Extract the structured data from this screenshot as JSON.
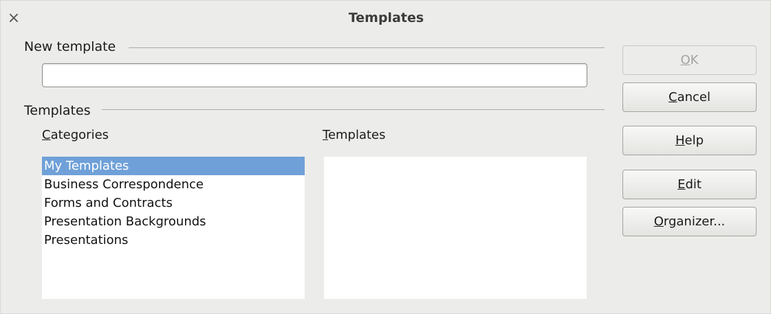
{
  "window": {
    "title": "Templates",
    "close_glyph": "×"
  },
  "new_template": {
    "section_label": "New template",
    "input_value": ""
  },
  "templates_section": {
    "section_label": "Templates",
    "categories": {
      "label_mnemonic": "C",
      "label_rest": "ategories",
      "items": [
        "My Templates",
        "Business Correspondence",
        "Forms and Contracts",
        "Presentation Backgrounds",
        "Presentations"
      ],
      "selected_index": 0
    },
    "templates": {
      "label_mnemonic": "T",
      "label_rest": "emplates",
      "items": []
    }
  },
  "buttons": {
    "ok": {
      "mnemonic": "O",
      "rest": "K",
      "enabled": false
    },
    "cancel": {
      "mnemonic": "C",
      "rest": "ancel",
      "enabled": true
    },
    "help": {
      "mnemonic": "H",
      "rest": "elp",
      "enabled": true
    },
    "edit": {
      "mnemonic": "E",
      "rest": "dit",
      "enabled": true
    },
    "organizer": {
      "mnemonic": "O",
      "rest": "rganizer...",
      "enabled": true
    }
  },
  "colors": {
    "selection": "#6fa0d8",
    "background": "#ececea"
  }
}
